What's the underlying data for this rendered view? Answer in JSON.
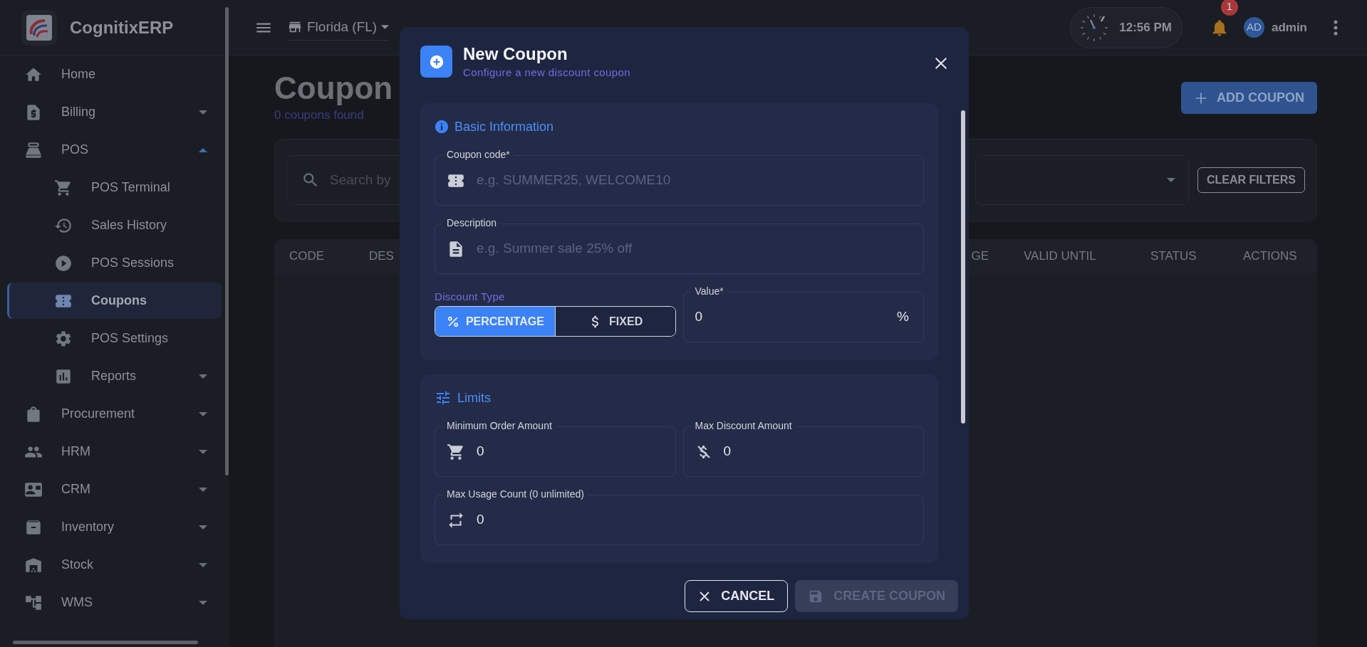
{
  "sidebar": {
    "brand": "CognitixERP",
    "items": [
      {
        "label": "Home",
        "kind": "link",
        "selected": false
      },
      {
        "label": "Billing",
        "kind": "group",
        "expanded": false,
        "selected": false
      },
      {
        "label": "POS",
        "kind": "group",
        "expanded": true,
        "selected": false,
        "children": [
          {
            "label": "POS Terminal",
            "kind": "link",
            "selected": false
          },
          {
            "label": "Sales History",
            "kind": "link",
            "selected": false
          },
          {
            "label": "POS Sessions",
            "kind": "link",
            "selected": false
          },
          {
            "label": "Coupons",
            "kind": "link",
            "selected": true
          },
          {
            "label": "POS Settings",
            "kind": "link",
            "selected": false
          },
          {
            "label": "Reports",
            "kind": "group",
            "expanded": false,
            "selected": false
          }
        ]
      },
      {
        "label": "Procurement",
        "kind": "group",
        "expanded": false,
        "selected": false
      },
      {
        "label": "HRM",
        "kind": "group",
        "expanded": false,
        "selected": false
      },
      {
        "label": "CRM",
        "kind": "group",
        "expanded": false,
        "selected": false
      },
      {
        "label": "Inventory",
        "kind": "group",
        "expanded": false,
        "selected": false
      },
      {
        "label": "Stock",
        "kind": "group",
        "expanded": false,
        "selected": false
      },
      {
        "label": "WMS",
        "kind": "group",
        "expanded": false,
        "selected": false
      }
    ]
  },
  "top_bar": {
    "location": "Florida (FL)",
    "time": "12:56 PM",
    "notifications": "1",
    "avatar": "AD",
    "user": "admin"
  },
  "page": {
    "title": "Coupon",
    "count": "0 coupons found",
    "add_button": "ADD COUPON",
    "search_placeholder": "Search by",
    "clear_filters": "CLEAR FILTERS",
    "table": {
      "columns": [
        "CODE",
        "DES",
        "GE",
        "VALID UNTIL",
        "STATUS",
        "ACTIONS"
      ]
    }
  },
  "dialog": {
    "title": "New Coupon",
    "subtitle": "Configure a new discount coupon",
    "sections": [
      {
        "title": "Basic Information",
        "rows": [
          [
            {
              "kind": "text",
              "label": "Coupon code*",
              "placeholder": "e.g. SUMMER25, WELCOME10"
            }
          ],
          [
            {
              "kind": "text",
              "label": "Description",
              "placeholder": "e.g. Summer sale 25% off"
            }
          ],
          [
            {
              "kind": "segmented",
              "label": "Discount Type",
              "options": [
                {
                  "label": "PERCENTAGE",
                  "selected": true
                },
                {
                  "label": "FIXED",
                  "selected": false
                }
              ]
            },
            {
              "kind": "number",
              "label": "Value*",
              "value": "0",
              "suffix": "%"
            }
          ]
        ]
      },
      {
        "title": "Limits",
        "rows": [
          [
            {
              "kind": "number",
              "label": "Minimum Order Amount",
              "value": "0"
            },
            {
              "kind": "number",
              "label": "Max Discount Amount",
              "value": "0"
            }
          ],
          [
            {
              "kind": "number",
              "label": "Max Usage Count (0 unlimited)",
              "value": "0"
            }
          ]
        ]
      }
    ],
    "buttons": [
      {
        "label": "CANCEL",
        "disabled": false
      },
      {
        "label": "CREATE COUPON",
        "disabled": true
      }
    ]
  }
}
